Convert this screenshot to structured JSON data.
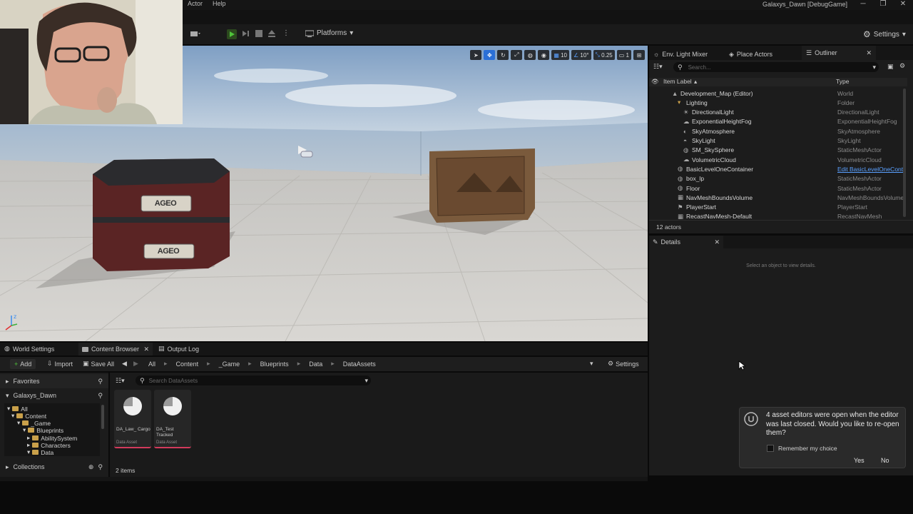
{
  "menu": [
    "Actor",
    "Help"
  ],
  "window": {
    "title": "Galaxys_Dawn [DebugGame]",
    "minimize": "─",
    "restore": "❐",
    "close": "✕"
  },
  "toolbar": {
    "platforms_label": "Platforms",
    "settings_label": "Settings"
  },
  "viewport": {
    "toolbar_values": {
      "grid": "10",
      "rotation": "10°",
      "scale": "0.25",
      "camera_speed": "1"
    },
    "crate_labels": [
      "AGEO",
      "AGEO"
    ]
  },
  "outliner": {
    "tabs": [
      "Env. Light Mixer",
      "Place Actors",
      "Outliner"
    ],
    "search_placeholder": "Search...",
    "col_label": "Item Label",
    "col_type": "Type",
    "rows": [
      {
        "label": "Development_Map (Editor)",
        "type": "World"
      },
      {
        "label": "Lighting",
        "type": "Folder"
      },
      {
        "label": "DirectionalLight",
        "type": "DirectionalLight"
      },
      {
        "label": "ExponentialHeightFog",
        "type": "ExponentialHeightFog"
      },
      {
        "label": "SkyAtmosphere",
        "type": "SkyAtmosphere"
      },
      {
        "label": "SkyLight",
        "type": "SkyLight"
      },
      {
        "label": "SM_SkySphere",
        "type": "StaticMeshActor"
      },
      {
        "label": "VolumetricCloud",
        "type": "VolumetricCloud"
      },
      {
        "label": "BasicLevelOneContainer",
        "type": "Edit BasicLevelOneCont"
      },
      {
        "label": "box_lp",
        "type": "StaticMeshActor"
      },
      {
        "label": "Floor",
        "type": "StaticMeshActor"
      },
      {
        "label": "NavMeshBoundsVolume",
        "type": "NavMeshBoundsVolume"
      },
      {
        "label": "PlayerStart",
        "type": "PlayerStart"
      },
      {
        "label": "RecastNavMesh-Default",
        "type": "RecastNavMesh"
      }
    ],
    "actor_count": "12 actors"
  },
  "details": {
    "tab": "Details",
    "empty_text": "Select an object to view details."
  },
  "bottom_tabs": [
    "World Settings",
    "Content Browser",
    "Output Log"
  ],
  "content_browser": {
    "add_label": "Add",
    "import_label": "Import",
    "save_all_label": "Save All",
    "breadcrumb": [
      "All",
      "Content",
      "_Game",
      "Blueprints",
      "Data",
      "DataAssets"
    ],
    "settings_label": "Settings",
    "search_placeholder": "Search DataAssets",
    "favorites_label": "Favorites",
    "project_label": "Galaxys_Dawn",
    "collections_label": "Collections",
    "tree": [
      "All",
      "Content",
      "_Game",
      "Blueprints",
      "AbilitySystem",
      "Characters",
      "Data"
    ],
    "assets": [
      {
        "name": "DA_Law_ Cargo",
        "type": "Data Asset"
      },
      {
        "name": "DA_Test Tracked",
        "type": "Data Asset"
      }
    ],
    "item_count": "2 items"
  },
  "notification": {
    "message": "4 asset editors were open when the editor was last closed. Would you like to re-open them?",
    "remember_label": "Remember my choice",
    "yes_label": "Yes",
    "no_label": "No"
  }
}
